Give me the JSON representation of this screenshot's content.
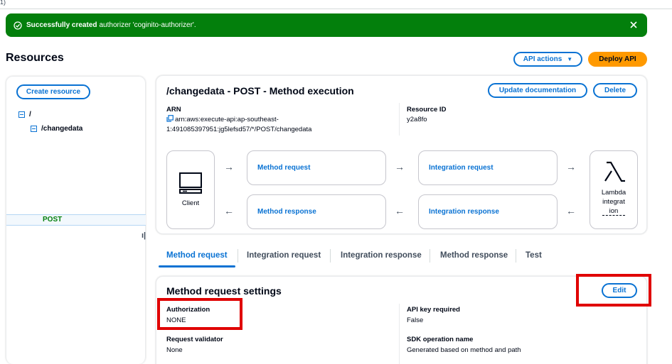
{
  "top_strip": {
    "text": "1)"
  },
  "flash": {
    "bold_text": "Successfully created",
    "text": "authorizer 'coginito-authorizer'.",
    "icon": "check-circle-icon",
    "close_icon": "close-icon",
    "color": "#037f0c"
  },
  "page": {
    "title": "Resources",
    "api_actions_label": "API actions",
    "deploy_label": "Deploy API"
  },
  "tree": {
    "create_resource_label": "Create resource",
    "root": "/",
    "child": "/changedata",
    "method": "POST"
  },
  "method_execution": {
    "title": "/changedata - POST - Method execution",
    "update_doc_label": "Update documentation",
    "delete_label": "Delete",
    "arn_label": "ARN",
    "arn_line1": "arn:aws:execute-api:ap-southeast-",
    "arn_line2": "1:491085397951:jg5lefsd57/*/POST/changedata",
    "resource_id_label": "Resource ID",
    "resource_id": "y2a8fo",
    "client_label": "Client",
    "method_request": "Method request",
    "integration_request": "Integration request",
    "method_response": "Method response",
    "integration_response": "Integration response",
    "lambda_line1": "Lambda",
    "lambda_line2": "integrat",
    "lambda_line3": "ion"
  },
  "tabs": [
    {
      "label": "Method request",
      "active": true
    },
    {
      "label": "Integration request",
      "active": false
    },
    {
      "label": "Integration response",
      "active": false
    },
    {
      "label": "Method response",
      "active": false
    },
    {
      "label": "Test",
      "active": false
    }
  ],
  "settings": {
    "title": "Method request settings",
    "edit_label": "Edit",
    "authorization_label": "Authorization",
    "authorization_value": "NONE",
    "api_key_label": "API key required",
    "api_key_value": "False",
    "validator_label": "Request validator",
    "validator_value": "None",
    "sdk_label": "SDK operation name",
    "sdk_value": "Generated based on method and path"
  },
  "colors": {
    "accent": "#0972d3",
    "primary_button": "#ff9900",
    "success": "#037f0c",
    "highlight": "#e00000"
  }
}
